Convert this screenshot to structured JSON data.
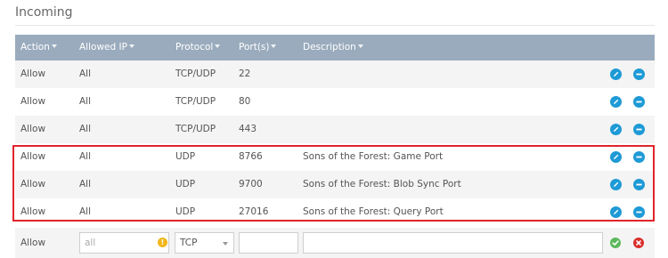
{
  "section": {
    "title": "Incoming"
  },
  "columns": {
    "action": "Action",
    "allowed_ip": "Allowed IP",
    "protocol": "Protocol",
    "ports": "Port(s)",
    "description": "Description"
  },
  "rules": [
    {
      "action": "Allow",
      "ip": "All",
      "protocol": "TCP/UDP",
      "port": "22",
      "description": ""
    },
    {
      "action": "Allow",
      "ip": "All",
      "protocol": "TCP/UDP",
      "port": "80",
      "description": ""
    },
    {
      "action": "Allow",
      "ip": "All",
      "protocol": "TCP/UDP",
      "port": "443",
      "description": ""
    },
    {
      "action": "Allow",
      "ip": "All",
      "protocol": "UDP",
      "port": "8766",
      "description": "Sons of the Forest: Game Port"
    },
    {
      "action": "Allow",
      "ip": "All",
      "protocol": "UDP",
      "port": "9700",
      "description": "Sons of the Forest: Blob Sync Port"
    },
    {
      "action": "Allow",
      "ip": "All",
      "protocol": "UDP",
      "port": "27016",
      "description": "Sons of the Forest: Query Port"
    }
  ],
  "add_rule": {
    "action": "Allow",
    "ip_placeholder": "all",
    "ip_value": "",
    "protocol": "TCP",
    "port_value": "",
    "description_value": ""
  },
  "icons": {
    "edit": "pencil-icon",
    "remove": "minus-circle-icon",
    "warning": "warning-icon",
    "confirm": "check-icon",
    "cancel": "x-icon"
  },
  "colors": {
    "header_bg": "#9aabbd",
    "accent_blue": "#1e9ad6",
    "highlight_red": "#e0242c",
    "confirm_green": "#5cb85c",
    "cancel_red": "#d9302c",
    "warning_yellow": "#f2b71d"
  }
}
